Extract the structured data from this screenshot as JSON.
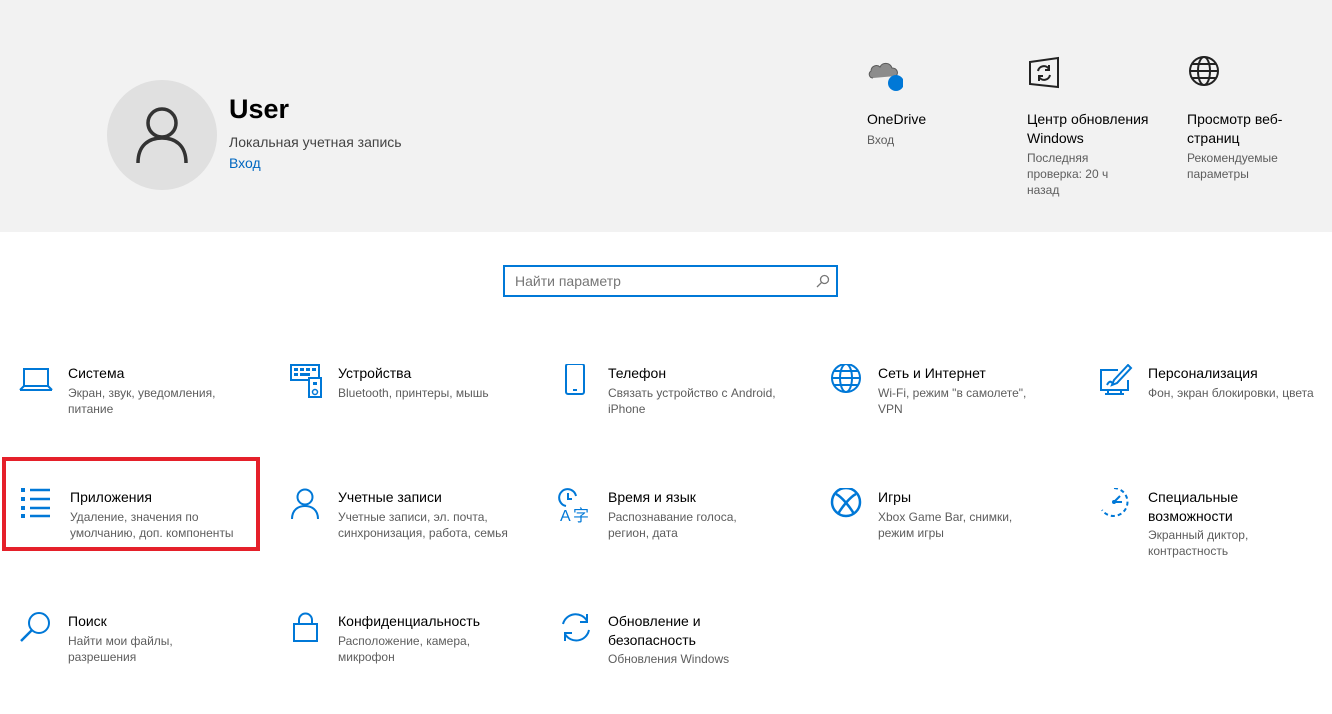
{
  "header": {
    "user_name": "User",
    "account_type": "Локальная учетная запись",
    "signin_link": "Вход"
  },
  "quick_links": [
    {
      "title": "OneDrive",
      "subtitle": "Вход",
      "icon": "onedrive-cloud-icon"
    },
    {
      "title": "Центр обновления Windows",
      "subtitle": "Последняя проверка: 20 ч назад",
      "icon": "windows-update-icon"
    },
    {
      "title": "Просмотр веб-страниц",
      "subtitle": "Рекомендуемые параметры",
      "icon": "globe-icon"
    }
  ],
  "search": {
    "placeholder": "Найти параметр"
  },
  "categories": [
    {
      "title": "Система",
      "subtitle": "Экран, звук, уведомления, питание",
      "icon": "laptop-icon"
    },
    {
      "title": "Устройства",
      "subtitle": "Bluetooth, принтеры, мышь",
      "icon": "devices-icon"
    },
    {
      "title": "Телефон",
      "subtitle": "Связать устройство с Android, iPhone",
      "icon": "phone-icon"
    },
    {
      "title": "Сеть и Интернет",
      "subtitle": "Wi-Fi, режим \"в самолете\", VPN",
      "icon": "globe-icon"
    },
    {
      "title": "Персонализация",
      "subtitle": "Фон, экран блокировки, цвета",
      "icon": "personalization-icon"
    },
    {
      "title": "Приложения",
      "subtitle": "Удаление, значения по умолчанию, доп. компоненты",
      "icon": "apps-list-icon",
      "selected": true
    },
    {
      "title": "Учетные записи",
      "subtitle": "Учетные записи, эл. почта, синхронизация, работа, семья",
      "icon": "person-icon"
    },
    {
      "title": "Время и язык",
      "subtitle": "Распознавание голоса, регион, дата",
      "icon": "time-language-icon"
    },
    {
      "title": "Игры",
      "subtitle": "Xbox Game Bar, снимки, режим игры",
      "icon": "xbox-icon"
    },
    {
      "title": "Специальные возможности",
      "subtitle": "Экранный диктор, контрастность",
      "icon": "accessibility-icon"
    },
    {
      "title": "Поиск",
      "subtitle": "Найти мои файлы, разрешения",
      "icon": "search-icon"
    },
    {
      "title": "Конфиденциальность",
      "subtitle": "Расположение, камера, микрофон",
      "icon": "lock-icon"
    },
    {
      "title": "Обновление и безопасность",
      "subtitle": "Обновления Windows",
      "icon": "sync-icon"
    }
  ],
  "colors": {
    "accent": "#0078d7",
    "header_bg": "#f2f2f2",
    "highlight_border": "#e5202a"
  }
}
